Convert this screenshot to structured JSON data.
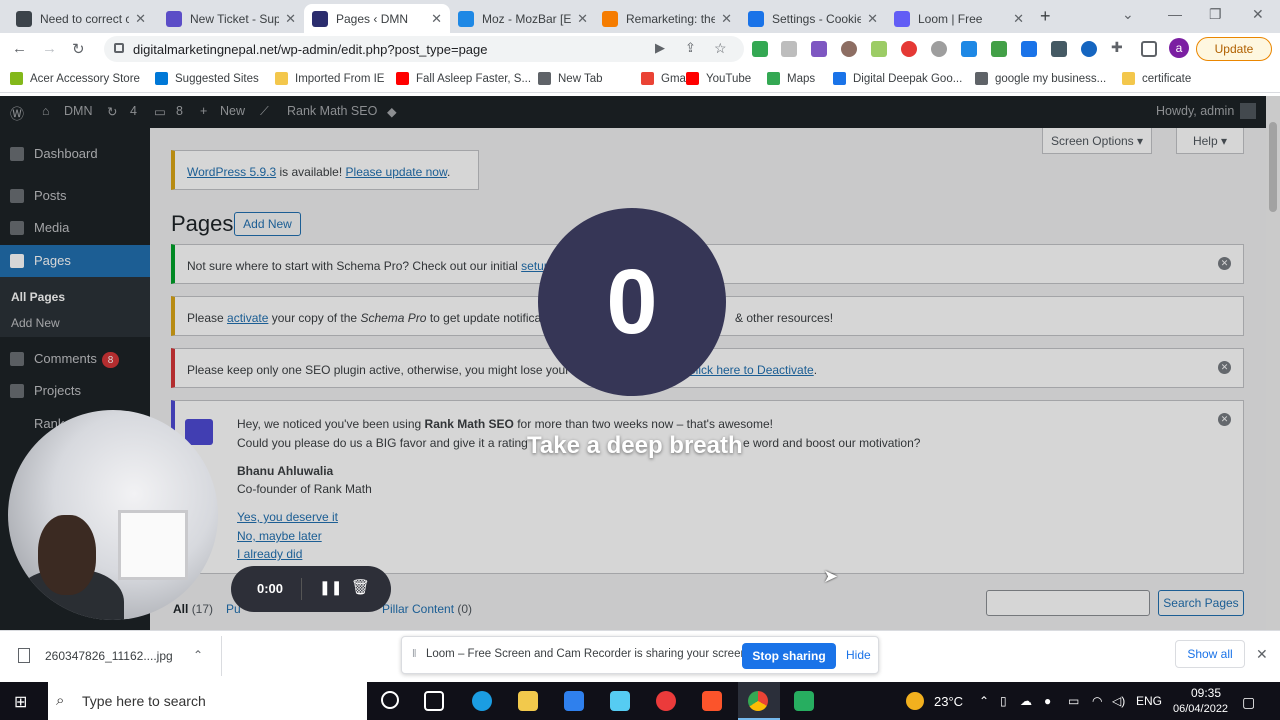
{
  "browser": {
    "tabs": [
      {
        "title": "Need to correct c",
        "icon": "wordpress-icon",
        "color": "#3c434a"
      },
      {
        "title": "New Ticket - Sup",
        "icon": "ticket-icon",
        "color": "#5b4dc7"
      },
      {
        "title": "Pages ‹ DMN",
        "icon": "rankmath-icon",
        "color": "#2b2d6e"
      },
      {
        "title": "Moz - MozBar [E",
        "icon": "moz-icon",
        "color": "#1e88e5"
      },
      {
        "title": "Remarketing: the",
        "icon": "g-icon",
        "color": "#f57c00"
      },
      {
        "title": "Settings - Cookie",
        "icon": "gear-icon",
        "color": "#1a73e8"
      },
      {
        "title": "Loom | Free",
        "icon": "loom-icon",
        "color": "#625df5"
      }
    ],
    "active_tab": 2,
    "url": "digitalmarketingnepal.net/wp-admin/edit.php?post_type=page",
    "update_label": "Update",
    "profile_initial": "a",
    "bookmarks": [
      {
        "label": "Acer Accessory Store",
        "color": "#83b81a"
      },
      {
        "label": "Suggested Sites",
        "color": "#0078d7"
      },
      {
        "label": "Imported From IE",
        "color": "#f3c74c"
      },
      {
        "label": "Fall Asleep Faster, S...",
        "color": "#ff0000"
      },
      {
        "label": "New Tab",
        "color": "#5f6368"
      },
      {
        "label": "Gmail",
        "color": "#ea4335"
      },
      {
        "label": "YouTube",
        "color": "#ff0000"
      },
      {
        "label": "Maps",
        "color": "#34a853"
      },
      {
        "label": "Digital Deepak Goo...",
        "color": "#1a73e8"
      },
      {
        "label": "google my business...",
        "color": "#5f6368"
      },
      {
        "label": "certificate",
        "color": "#f3c74c"
      }
    ]
  },
  "wp": {
    "adminbar": {
      "site": "DMN",
      "updates": "4",
      "comments": "8",
      "new": "New",
      "rankmath": "Rank Math SEO",
      "howdy": "Howdy, admin"
    },
    "sidebar": {
      "dashboard": "Dashboard",
      "posts": "Posts",
      "media": "Media",
      "pages": "Pages",
      "all_pages": "All Pages",
      "add_new": "Add New",
      "comments": "Comments",
      "comments_count": "8",
      "projects": "Projects",
      "rank": "Rank"
    },
    "screen_options": "Screen Options ▾",
    "help": "Help ▾",
    "update_notice": {
      "link1": "WordPress 5.9.3",
      "mid": " is available! ",
      "link2": "Please update now",
      "end": "."
    },
    "page_title": "Pages",
    "add_new_button": "Add New",
    "notice_schema1": {
      "text": "Not sure where to start with Schema Pro? Check out our initial ",
      "link": "setup"
    },
    "notice_schema2": {
      "pre": "Please ",
      "link": "activate",
      "mid": " your copy of the ",
      "em": "Schema Pro",
      "rest": " to get update notifications",
      "tail": "& other resources!"
    },
    "notice_seo": {
      "text": "Please keep only one SEO plugin active, otherwise, you might lose your",
      "link": "Click here to Deactivate",
      "end": "."
    },
    "rankmath": {
      "line1a": "Hey, we noticed you've been using ",
      "line1b": "Rank Math SEO",
      "line1c": " for more than two weeks now – that's awesome!",
      "line2": "Could you please do us a BIG favor and give it a rating",
      "line2b": "e word and boost our motivation?",
      "name": "Bhanu Ahluwalia",
      "role": "Co-founder of Rank Math",
      "link1": "Yes, you deserve it",
      "link2": "No, maybe later",
      "link3": "I already did"
    },
    "filters": {
      "all": "All",
      "all_count": "(17)",
      "publ": "Pu",
      "pillar": "Pillar Content",
      "pillar_count": "(0)"
    },
    "search_button": "Search Pages"
  },
  "loom_overlay": {
    "countdown": "0",
    "message": "Take a deep breath",
    "timer": "0:00"
  },
  "download_bar": {
    "filename": "260347826_11162....jpg",
    "show_all": "Show all"
  },
  "loom_share": {
    "text": "Loom – Free Screen and Cam Recorder is sharing your screen.",
    "stop": "Stop sharing",
    "hide": "Hide"
  },
  "taskbar": {
    "search_placeholder": "Type here to search",
    "temperature": "23°C",
    "lang": "ENG",
    "time": "09:35",
    "date": "06/04/2022"
  }
}
